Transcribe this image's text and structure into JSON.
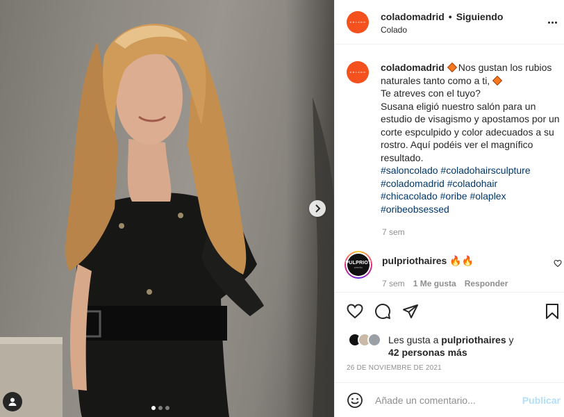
{
  "post": {
    "author": {
      "username": "coladomadrid",
      "location": "Colado",
      "follow_state": "Siguiendo",
      "separator": "•",
      "avatar_text": "C O L A D O"
    },
    "caption": {
      "username": "coladomadrid",
      "line1": "Nos gustan los rubios naturales tanto como a ti,",
      "line2": "Te atreves con el tuyo?",
      "line3": "Susana eligió nuestro salón para un estudio de visagismo y apostamos por un corte espculpido y color adecuados a su rostro. Aquí podéis ver el magnífico resultado.",
      "hashtags": [
        "#saloncolado",
        "#coladohairsculpture",
        "#coladomadrid",
        "#coladohair",
        "#chicacolado",
        "#oribe",
        "#olaplex",
        "#oribeobsessed"
      ],
      "time": "7 sem"
    },
    "comment": {
      "username": "pulpriothaires",
      "text": "🔥🔥",
      "avatar_text": "PULPRIOT",
      "avatar_sub": "ESPAÑA",
      "time": "7 sem",
      "likes": "1 Me gusta",
      "reply": "Responder"
    },
    "likes": {
      "prefix": "Les gusta a",
      "user": "pulpriothaires",
      "joiner": "y",
      "others": "42 personas más"
    },
    "date": "26 DE NOVIEMBRE DE 2021",
    "composer": {
      "placeholder": "Añade un comentario...",
      "post_label": "Publicar"
    }
  },
  "media": {
    "carousel_count": 3,
    "carousel_index": 0
  },
  "colors": {
    "brand": "#f4511e",
    "link": "#00376b",
    "muted": "#8e8e8e",
    "post_disabled": "#b2dffc"
  }
}
